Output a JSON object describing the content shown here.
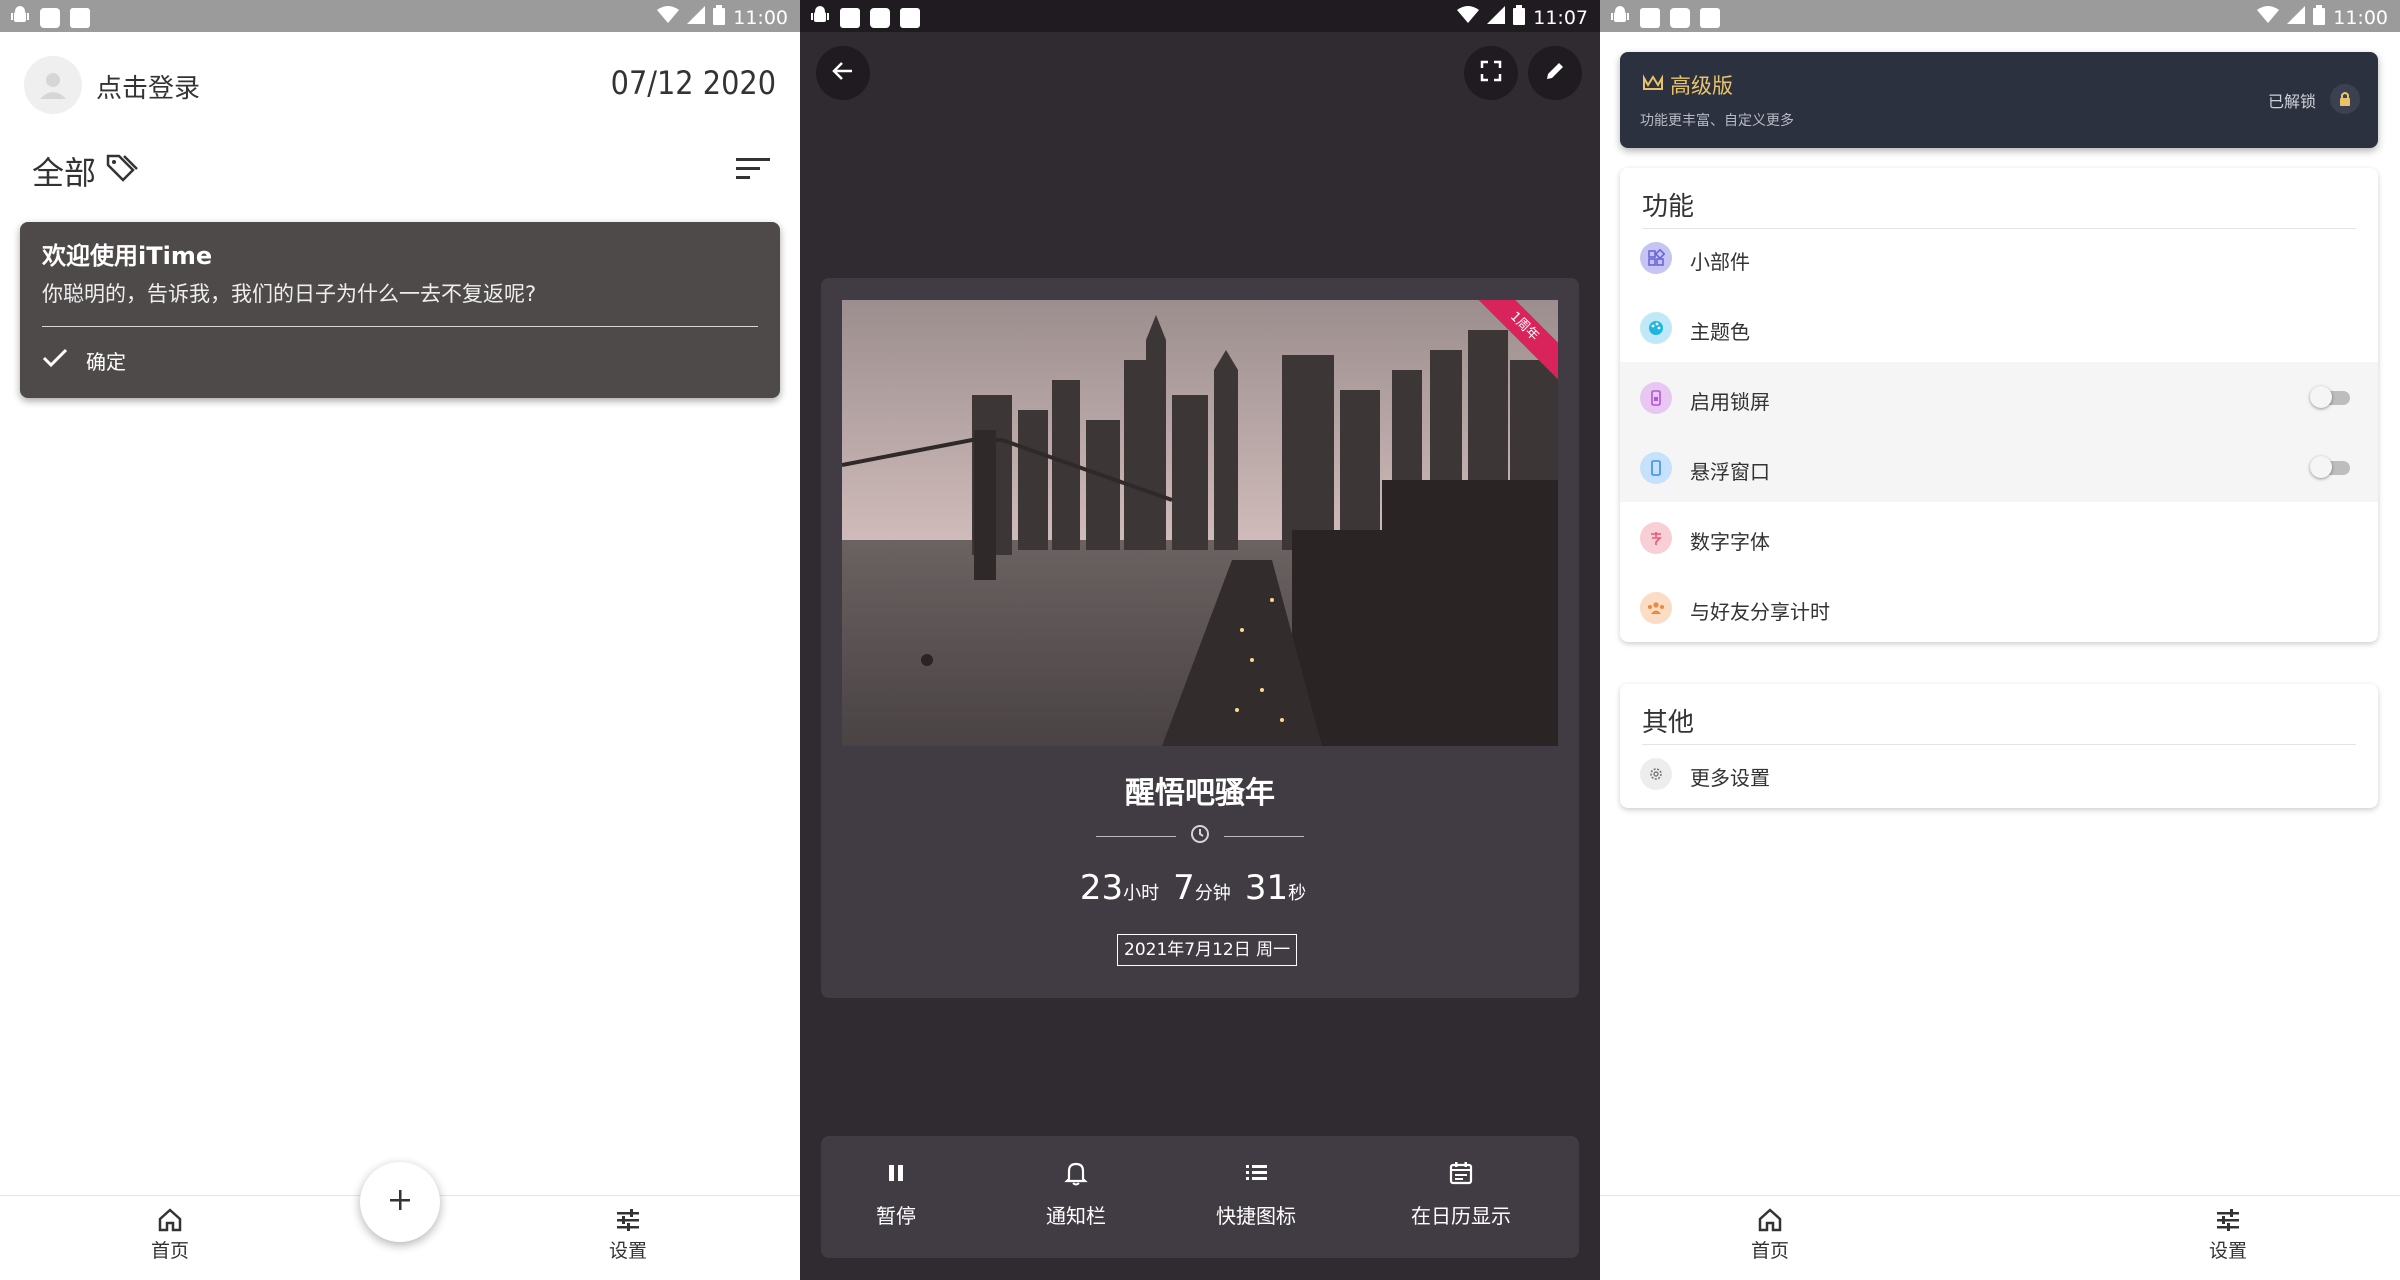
{
  "panel1": {
    "status_time": "11:00",
    "login_label": "点击登录",
    "date_display": "07/12 2020",
    "filter_title": "全部",
    "welcome": {
      "title": "欢迎使用iTime",
      "body": "你聪明的，告诉我，我们的日子为什么一去不复返呢?",
      "confirm": "确定"
    },
    "nav": {
      "home": "首页",
      "settings": "设置"
    }
  },
  "panel2": {
    "status_time": "11:07",
    "ribbon": "1周年",
    "event_title": "醒悟吧骚年",
    "countdown": {
      "hours": "23",
      "hours_unit": "小时",
      "minutes": "7",
      "minutes_unit": "分钟",
      "seconds": "31",
      "seconds_unit": "秒"
    },
    "target_date": "2021年7月12日 周一",
    "actions": {
      "pause": "暂停",
      "notify": "通知栏",
      "shortcut": "快捷图标",
      "calendar": "在日历显示"
    }
  },
  "panel3": {
    "status_time": "11:00",
    "premium": {
      "title": "高级版",
      "subtitle": "功能更丰富、自定义更多",
      "status": "已解锁"
    },
    "features_title": "功能",
    "features": [
      {
        "label": "小部件",
        "icon": "widgets-icon",
        "color": "#c5c4f2",
        "toggle": null
      },
      {
        "label": "主题色",
        "icon": "palette-icon",
        "color": "#bfe9f6",
        "toggle": null
      },
      {
        "label": "启用锁屏",
        "icon": "lockscreen-icon",
        "color": "#e8c8f2",
        "toggle": false
      },
      {
        "label": "悬浮窗口",
        "icon": "floating-window-icon",
        "color": "#c6e1fb",
        "toggle": false
      },
      {
        "label": "数字字体",
        "icon": "font-icon",
        "color": "#f9cfd6",
        "toggle": null
      },
      {
        "label": "与好友分享计时",
        "icon": "share-friends-icon",
        "color": "#fbdcc4",
        "toggle": null
      }
    ],
    "other_title": "其他",
    "other": [
      {
        "label": "更多设置",
        "icon": "gear-icon"
      }
    ],
    "nav": {
      "home": "首页",
      "settings": "设置"
    }
  }
}
